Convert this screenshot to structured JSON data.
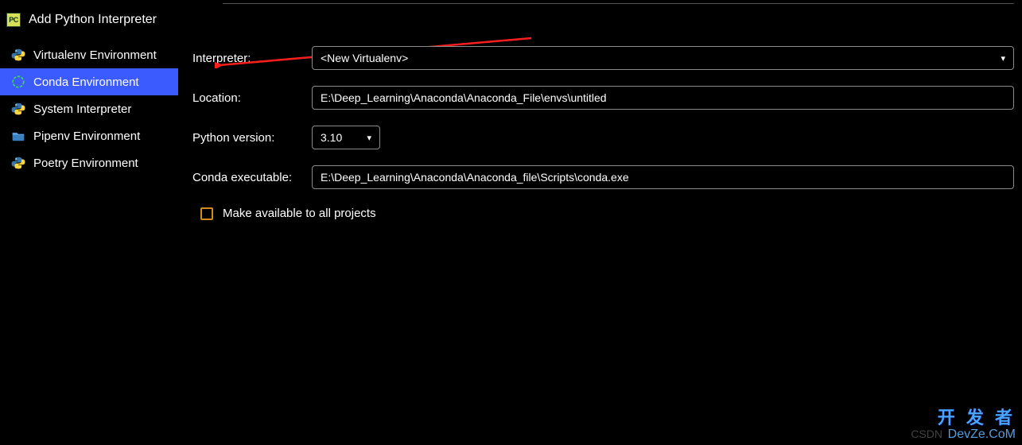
{
  "header": {
    "title": "Add Python Interpreter"
  },
  "sidebar": {
    "items": [
      {
        "label": "Virtualenv Environment",
        "icon": "python"
      },
      {
        "label": "Conda Environment",
        "icon": "conda"
      },
      {
        "label": "System Interpreter",
        "icon": "python"
      },
      {
        "label": "Pipenv Environment",
        "icon": "folder"
      },
      {
        "label": "Poetry Environment",
        "icon": "python"
      }
    ],
    "selected_index": 1
  },
  "form": {
    "interpreter_label": "Interpreter:",
    "interpreter_value": "<New Virtualenv>",
    "location_label": "Location:",
    "location_value": "E:\\Deep_Learning\\Anaconda\\Anaconda_File\\envs\\untitled",
    "python_version_label": "Python version:",
    "python_version_value": "3.10",
    "conda_exec_label": "Conda executable:",
    "conda_exec_value": "E:\\Deep_Learning\\Anaconda\\Anaconda_file\\Scripts\\conda.exe",
    "make_available_label": "Make available to all projects",
    "make_available_checked": false
  },
  "watermark": {
    "cn": "开 发 者",
    "en": "DevZe.CoM",
    "csdn": "CSDN"
  },
  "colors": {
    "selection": "#3b5bff",
    "checkbox_border": "#d38a1c",
    "arrow": "#ff1e1e"
  }
}
